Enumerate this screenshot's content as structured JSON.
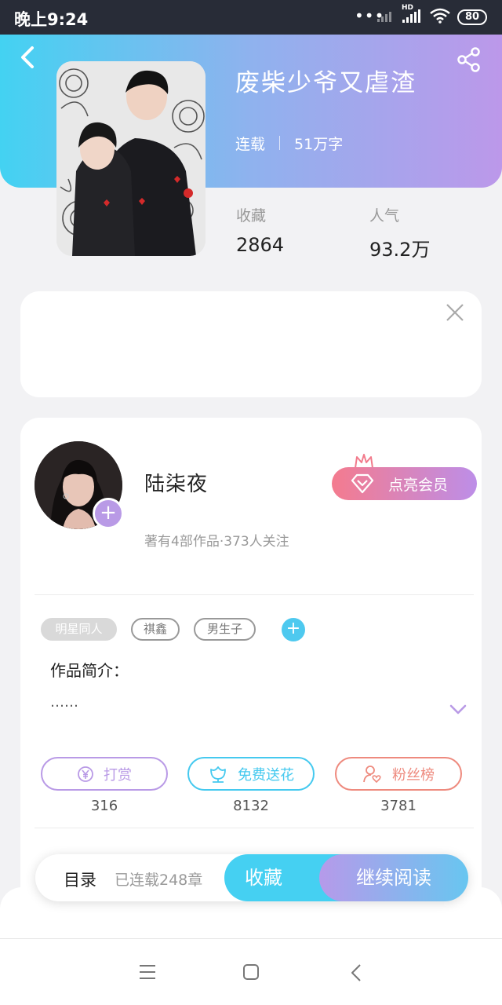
{
  "status_bar": {
    "time": "晚上9:24",
    "network_label": "HD",
    "battery": "80"
  },
  "book": {
    "title": "废柴少爷又虐渣",
    "status": "连载",
    "word_count": "51万字"
  },
  "stats": {
    "collect_label": "收藏",
    "collect_value": "2864",
    "popularity_label": "人气",
    "popularity_value": "93.2万"
  },
  "author": {
    "name": "陆柒夜",
    "info": "著有4部作品·373人关注",
    "vip_button": "点亮会员"
  },
  "tags": [
    "明星同人",
    "祺鑫",
    "男生子"
  ],
  "intro": {
    "title": "作品简介：",
    "text": "……"
  },
  "actions": [
    {
      "label": "打赏",
      "count": "316",
      "color": "#b99ae6"
    },
    {
      "label": "免费送花",
      "count": "8132",
      "color": "#45c9ef"
    },
    {
      "label": "粉丝榜",
      "count": "3781",
      "color": "#ee8a7e"
    }
  ],
  "bottom_bar": {
    "catalog": "目录",
    "chapters": "已连载248章",
    "collect": "收藏",
    "continue_read": "继续阅读"
  },
  "icons": {
    "back": "chevron-left-icon",
    "share": "share-icon",
    "close": "close-icon",
    "crown": "crown-icon",
    "diamond": "diamond-icon",
    "expand": "chevron-down-icon",
    "reward": "yen-coin-icon",
    "flower": "flower-icon",
    "fans": "user-heart-icon",
    "nav_menu": "menu-icon",
    "nav_home": "square-icon",
    "nav_back": "triangle-back-icon"
  },
  "colors": {
    "gradient_start": "#43d2f2",
    "gradient_end": "#bc98ea",
    "accent_blue": "#45d0f2",
    "accent_purple": "#b99ae6",
    "vip_pink": "#f47b8e"
  }
}
